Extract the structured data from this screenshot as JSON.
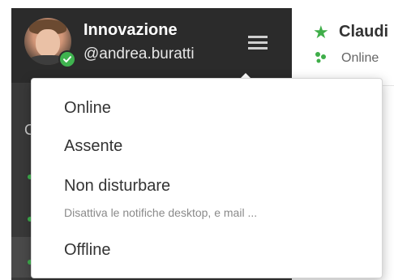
{
  "team": {
    "name": "Innovazione",
    "username": "@andrea.buratti",
    "status_icon": "check-circle-icon",
    "menu_icon": "hamburger-icon"
  },
  "sidebar": {
    "partial_letter": "C"
  },
  "channel": {
    "name": "Claudi",
    "status": "Online",
    "icon": "star-icon"
  },
  "status_menu": {
    "items": [
      {
        "label": "Online"
      },
      {
        "label": "Assente"
      },
      {
        "label": "Non disturbare",
        "sublabel": "Disattiva le notifiche desktop, e mail ..."
      },
      {
        "label": "Offline"
      }
    ]
  },
  "colors": {
    "sidebar_bg": "#2b2b2b",
    "online_green": "#3fb34f",
    "menu_text": "#333333",
    "sublabel_text": "#8a8a8a"
  }
}
